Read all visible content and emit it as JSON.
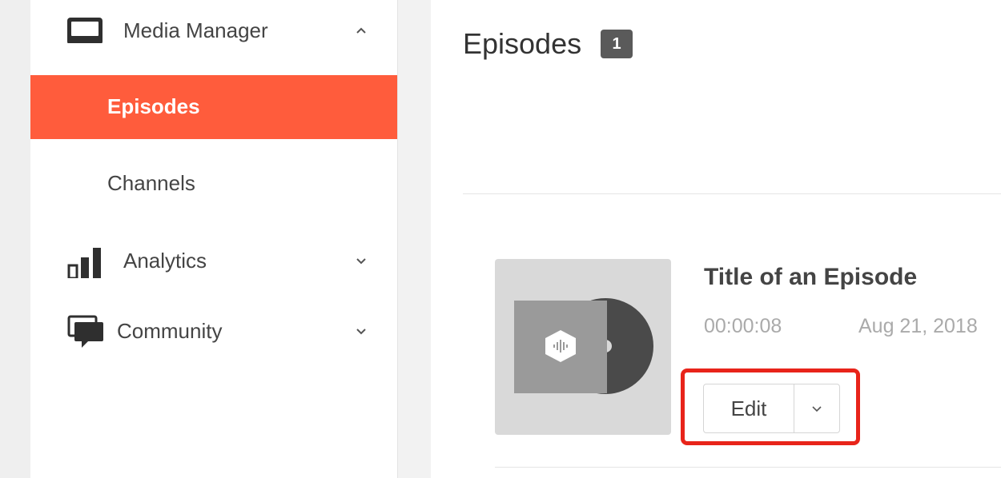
{
  "sidebar": {
    "sections": [
      {
        "label": "Media Manager",
        "icon": "inbox-icon",
        "chevron": "chevron-up-icon"
      },
      {
        "label": "Analytics",
        "icon": "bar-chart-icon",
        "chevron": "chevron-down-icon"
      },
      {
        "label": "Community",
        "icon": "chat-bubbles-icon",
        "chevron": "chevron-down-icon"
      }
    ],
    "media_items": [
      {
        "label": "Episodes",
        "active": true
      },
      {
        "label": "Channels",
        "active": false
      }
    ]
  },
  "main": {
    "title": "Episodes",
    "count": "1",
    "episode": {
      "title": "Title of an Episode",
      "duration": "00:00:08",
      "date": "Aug 21, 2018",
      "thumbnail_icon": "vinyl-record-icon"
    },
    "actions": {
      "edit_label": "Edit",
      "dropdown_icon": "chevron-down-icon"
    }
  },
  "colors": {
    "accent": "#ff5c3c",
    "highlight": "#e8241a",
    "badge_bg": "#5a5a5a"
  }
}
